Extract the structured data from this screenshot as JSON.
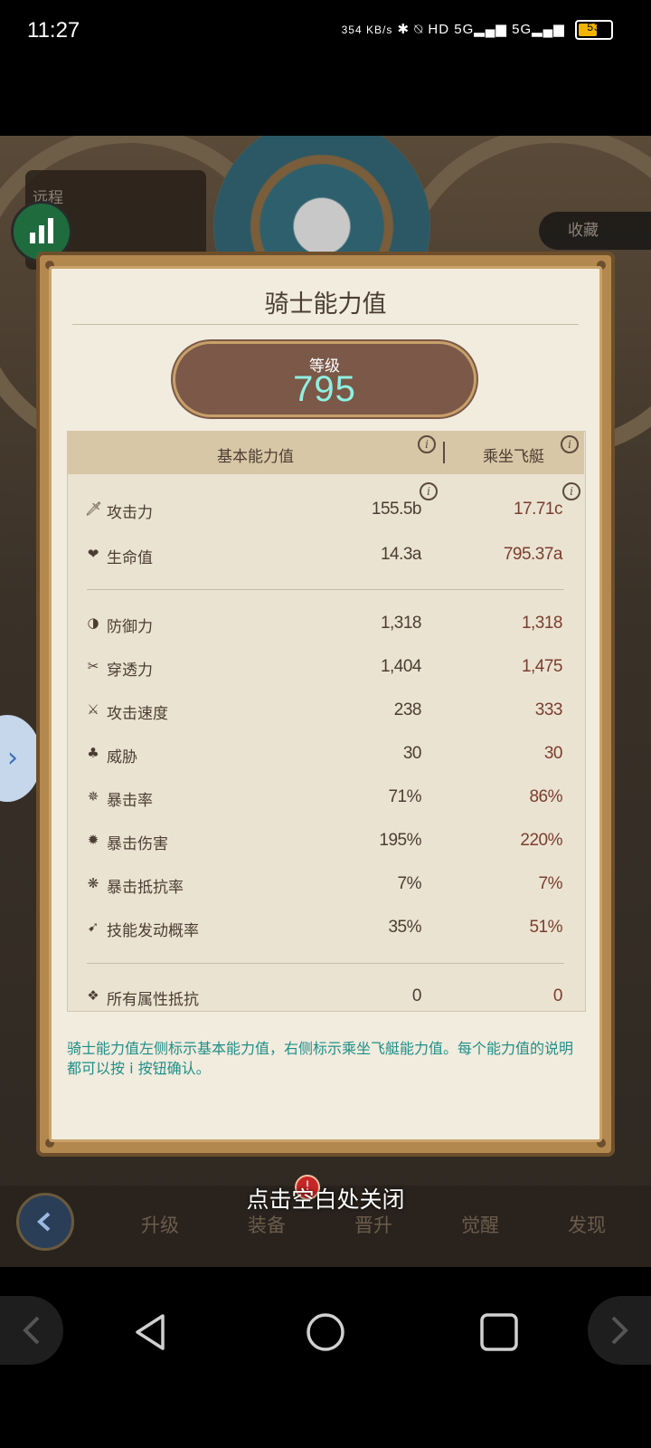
{
  "status_bar": {
    "time": "11:27",
    "net_speed": "354 KB/s",
    "icons_text": "✱ ⍉ HD 5G▂▄▆ 5G▂▄▆",
    "battery": "53"
  },
  "background": {
    "route_label": "远程",
    "collect_label": "收藏"
  },
  "modal": {
    "title": "骑士能力值",
    "level_label": "等级",
    "level_value": "795",
    "columns": {
      "base": "基本能力值",
      "airship": "乘坐飞艇"
    },
    "info_glyph": "i",
    "rows_primary": [
      {
        "icon": "sword-icon",
        "glyph": "🗡",
        "label": "攻击力",
        "base": "155.5b",
        "airship": "17.71c"
      },
      {
        "icon": "heart-icon",
        "glyph": "❤",
        "label": "生命值",
        "base": "14.3a",
        "airship": "795.37a"
      }
    ],
    "rows_secondary": [
      {
        "icon": "shield-icon",
        "glyph": "◑",
        "label": "防御力",
        "base": "1,318",
        "airship": "1,318"
      },
      {
        "icon": "pierce-icon",
        "glyph": "✂",
        "label": "穿透力",
        "base": "1,404",
        "airship": "1,475"
      },
      {
        "icon": "attack-speed-icon",
        "glyph": "⚔",
        "label": "攻击速度",
        "base": "238",
        "airship": "333"
      },
      {
        "icon": "threat-icon",
        "glyph": "♣",
        "label": "威胁",
        "base": "30",
        "airship": "30"
      },
      {
        "icon": "crit-rate-icon",
        "glyph": "✵",
        "label": "暴击率",
        "base": "71%",
        "airship": "86%"
      },
      {
        "icon": "crit-damage-icon",
        "glyph": "✹",
        "label": "暴击伤害",
        "base": "195%",
        "airship": "220%"
      },
      {
        "icon": "crit-resist-icon",
        "glyph": "❋",
        "label": "暴击抵抗率",
        "base": "7%",
        "airship": "7%"
      },
      {
        "icon": "skill-proc-icon",
        "glyph": "➹",
        "label": "技能发动概率",
        "base": "35%",
        "airship": "51%"
      }
    ],
    "rows_tertiary": [
      {
        "icon": "all-resist-icon",
        "glyph": "❖",
        "label": "所有属性抵抗",
        "base": "0",
        "airship": "0"
      }
    ],
    "footer_note": "骑士能力值左侧标示基本能力值，右侧标示乘坐飞艇能力值。每个能力值的说明都可以按 i 按钮确认。"
  },
  "close_hint": "点击空白处关闭",
  "alert_badge": "!",
  "game_nav": [
    {
      "label": "升级"
    },
    {
      "label": "装备"
    },
    {
      "label": "晋升"
    },
    {
      "label": "觉醒"
    },
    {
      "label": "发现"
    }
  ],
  "colors": {
    "accent_teal": "#8ff0e2",
    "modal_frame": "#b3884f",
    "note_teal": "#1f8e88"
  }
}
